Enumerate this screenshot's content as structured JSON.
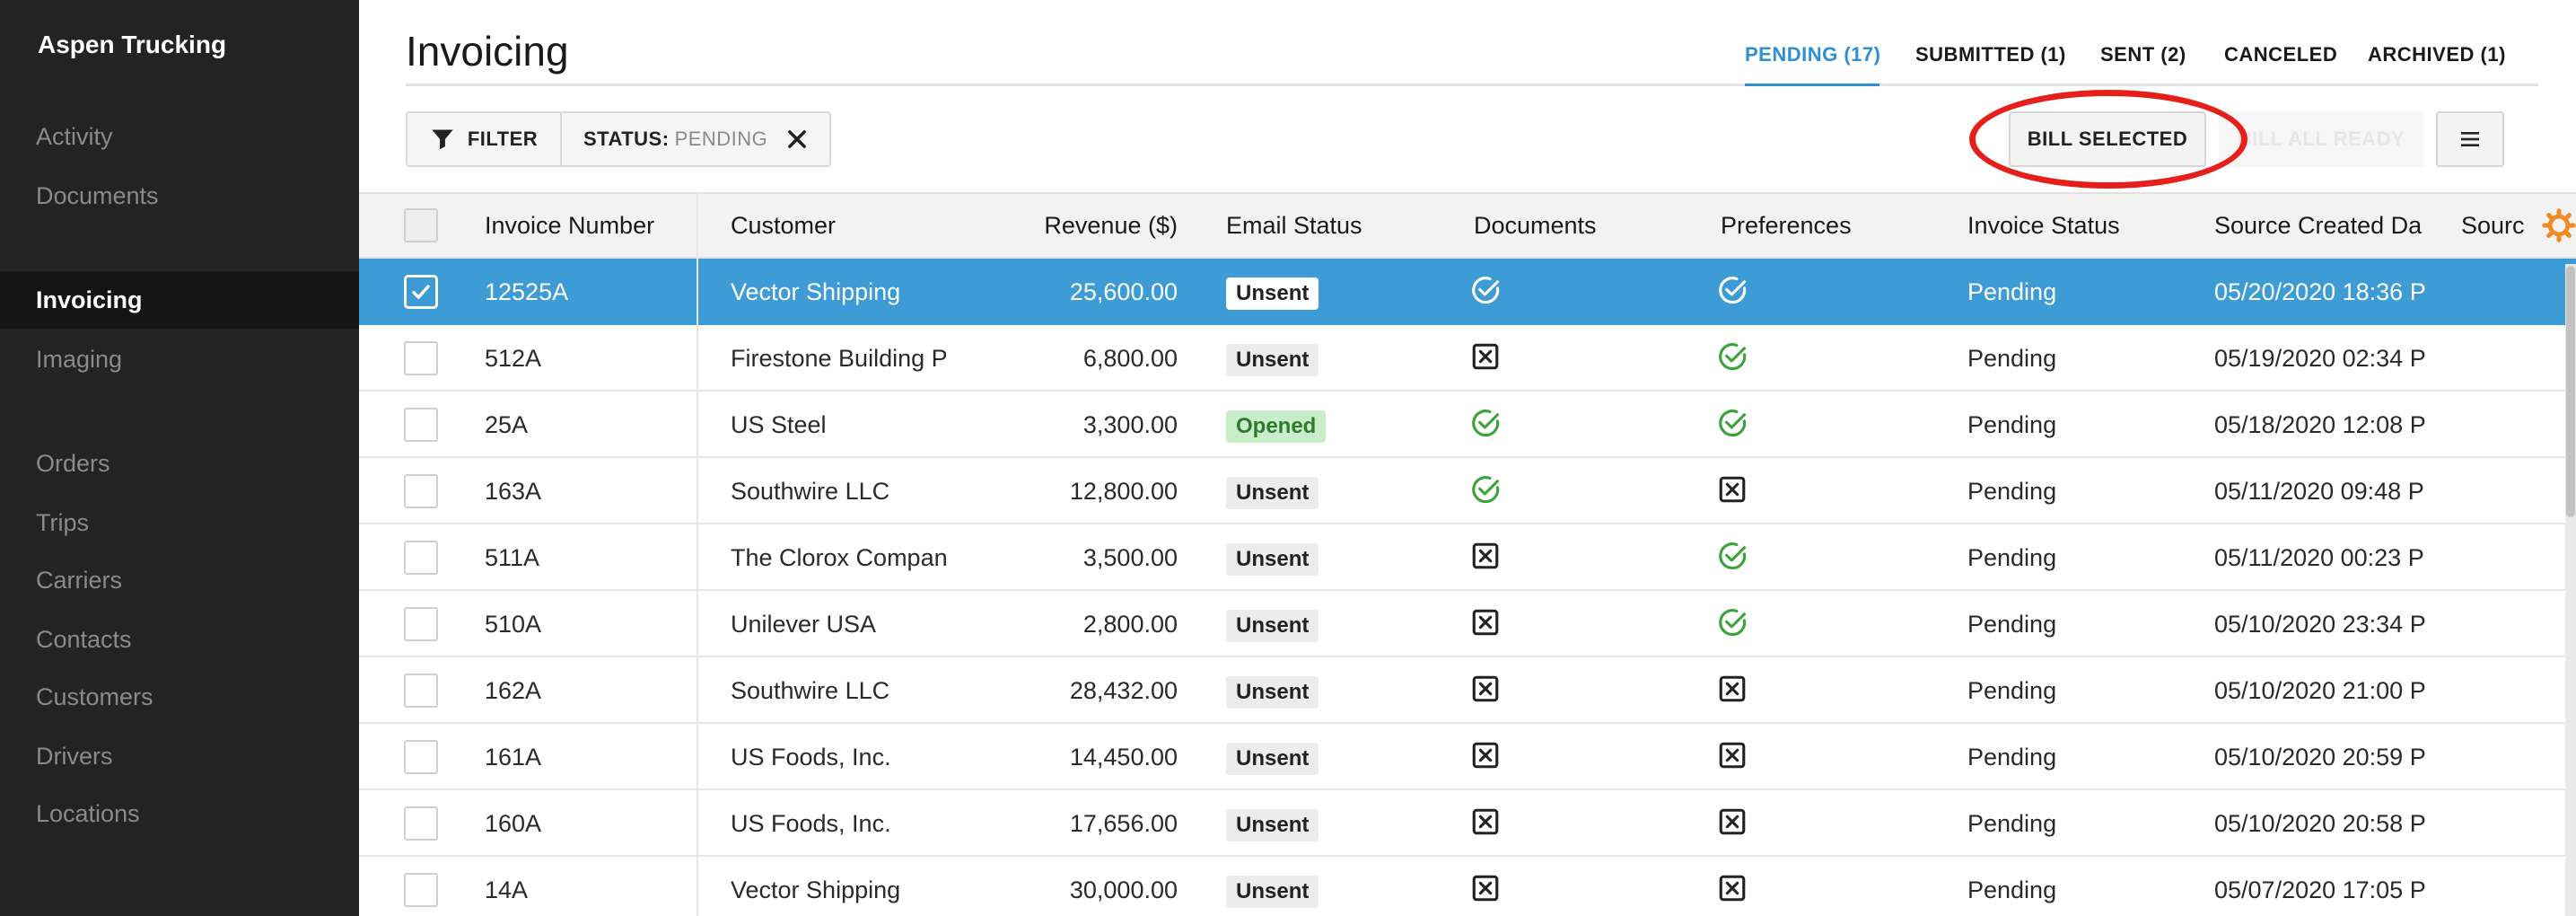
{
  "app": {
    "brand": "Aspen Trucking"
  },
  "sidebar": {
    "items": [
      {
        "label": "Activity",
        "active": false
      },
      {
        "label": "Documents",
        "active": false
      },
      {
        "label": "Invoicing",
        "active": true
      },
      {
        "label": "Imaging",
        "active": false
      },
      {
        "label": "Orders",
        "active": false
      },
      {
        "label": "Trips",
        "active": false
      },
      {
        "label": "Carriers",
        "active": false
      },
      {
        "label": "Contacts",
        "active": false
      },
      {
        "label": "Customers",
        "active": false
      },
      {
        "label": "Drivers",
        "active": false
      },
      {
        "label": "Locations",
        "active": false
      }
    ]
  },
  "header": {
    "title": "Invoicing"
  },
  "tabs": [
    {
      "label": "PENDING (17)",
      "active": true
    },
    {
      "label": "SUBMITTED (1)",
      "active": false
    },
    {
      "label": "SENT (2)",
      "active": false
    },
    {
      "label": "CANCELED",
      "active": false
    },
    {
      "label": "ARCHIVED (1)",
      "active": false
    }
  ],
  "toolbar": {
    "filter_label": "FILTER",
    "status_key": "STATUS:",
    "status_value": "PENDING",
    "bill_selected_label": "BILL SELECTED",
    "bill_all_ready_label": "BILL ALL READY"
  },
  "table": {
    "columns": [
      "Invoice Number",
      "Customer",
      "Revenue ($)",
      "Email Status",
      "Documents",
      "Preferences",
      "Invoice Status",
      "Source Created Da",
      "Sourc"
    ],
    "rows": [
      {
        "selected": true,
        "invoice": "12525A",
        "customer": "Vector Shipping",
        "revenue": "25,600.00",
        "email": "Unsent",
        "documents": "check",
        "preferences": "check",
        "status": "Pending",
        "created": "05/20/2020 18:36 P"
      },
      {
        "selected": false,
        "invoice": "512A",
        "customer": "Firestone Building P",
        "revenue": "6,800.00",
        "email": "Unsent",
        "documents": "x",
        "preferences": "check",
        "status": "Pending",
        "created": "05/19/2020 02:34 P"
      },
      {
        "selected": false,
        "invoice": "25A",
        "customer": "US Steel",
        "revenue": "3,300.00",
        "email": "Opened",
        "documents": "check",
        "preferences": "check",
        "status": "Pending",
        "created": "05/18/2020 12:08 P"
      },
      {
        "selected": false,
        "invoice": "163A",
        "customer": "Southwire LLC",
        "revenue": "12,800.00",
        "email": "Unsent",
        "documents": "check",
        "preferences": "x",
        "status": "Pending",
        "created": "05/11/2020 09:48 P"
      },
      {
        "selected": false,
        "invoice": "511A",
        "customer": "The Clorox Compan",
        "revenue": "3,500.00",
        "email": "Unsent",
        "documents": "x",
        "preferences": "check",
        "status": "Pending",
        "created": "05/11/2020 00:23 P"
      },
      {
        "selected": false,
        "invoice": "510A",
        "customer": "Unilever USA",
        "revenue": "2,800.00",
        "email": "Unsent",
        "documents": "x",
        "preferences": "check",
        "status": "Pending",
        "created": "05/10/2020 23:34 P"
      },
      {
        "selected": false,
        "invoice": "162A",
        "customer": "Southwire LLC",
        "revenue": "28,432.00",
        "email": "Unsent",
        "documents": "x",
        "preferences": "x",
        "status": "Pending",
        "created": "05/10/2020 21:00 P"
      },
      {
        "selected": false,
        "invoice": "161A",
        "customer": "US Foods, Inc.",
        "revenue": "14,450.00",
        "email": "Unsent",
        "documents": "x",
        "preferences": "x",
        "status": "Pending",
        "created": "05/10/2020 20:59 P"
      },
      {
        "selected": false,
        "invoice": "160A",
        "customer": "US Foods, Inc.",
        "revenue": "17,656.00",
        "email": "Unsent",
        "documents": "x",
        "preferences": "x",
        "status": "Pending",
        "created": "05/10/2020 20:58 P"
      },
      {
        "selected": false,
        "invoice": "14A",
        "customer": "Vector Shipping",
        "revenue": "30,000.00",
        "email": "Unsent",
        "documents": "x",
        "preferences": "x",
        "status": "Pending",
        "created": "05/07/2020 17:05 P"
      }
    ]
  },
  "icons": {
    "filter": "funnel-icon",
    "close": "close-icon",
    "menu": "hamburger-icon",
    "settings": "gear-icon",
    "check": "check-circle-icon",
    "x": "x-square-icon"
  },
  "colors": {
    "sidebar_bg": "#232323",
    "accent": "#2e8fd6",
    "selected_row": "#3d9bd6",
    "check_green": "#3aa33a",
    "annotation_red": "#e5201b",
    "gear_orange": "#f08a24"
  }
}
